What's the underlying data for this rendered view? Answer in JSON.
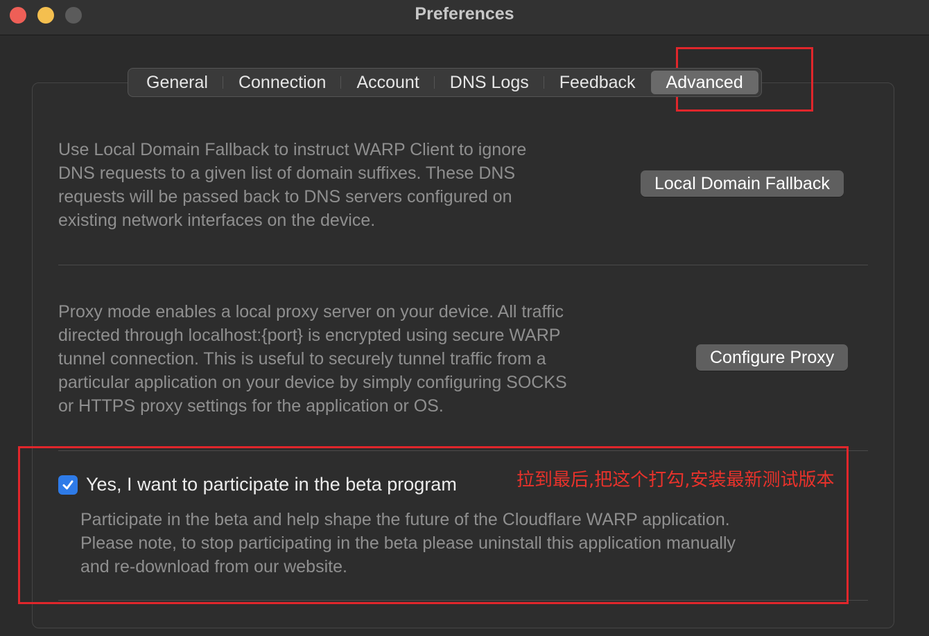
{
  "window": {
    "title": "Preferences"
  },
  "tabs": [
    {
      "label": "General",
      "active": false
    },
    {
      "label": "Connection",
      "active": false
    },
    {
      "label": "Account",
      "active": false
    },
    {
      "label": "DNS Logs",
      "active": false
    },
    {
      "label": "Feedback",
      "active": false
    },
    {
      "label": "Advanced",
      "active": true
    }
  ],
  "local_domain": {
    "lines": [
      "Use Local Domain Fallback to instruct WARP Client to ignore",
      "DNS requests to a given list of domain suffixes. These DNS",
      "requests will be passed back to DNS servers configured on",
      "existing network interfaces on the device."
    ],
    "button_label": "Local Domain Fallback"
  },
  "proxy": {
    "lines": [
      "Proxy mode enables a local proxy server on your device. All traffic",
      "directed through localhost:{port} is encrypted using secure WARP",
      "tunnel connection. This is useful to securely tunnel traffic from a",
      "particular application on your device by simply configuring SOCKS",
      "or HTTPS proxy settings for the application or OS."
    ],
    "button_label": "Configure Proxy"
  },
  "beta": {
    "checked": true,
    "checkbox_label": "Yes, I want to participate in the beta program",
    "lines": [
      "Participate in the beta and help shape the future of the Cloudflare WARP application.",
      "Please note, to stop participating in the beta please uninstall this application manually",
      "and re-download from our website."
    ]
  },
  "annotation": {
    "text": "拉到最后,把这个打勾,安装最新测试版本",
    "color": "#e8322b"
  }
}
